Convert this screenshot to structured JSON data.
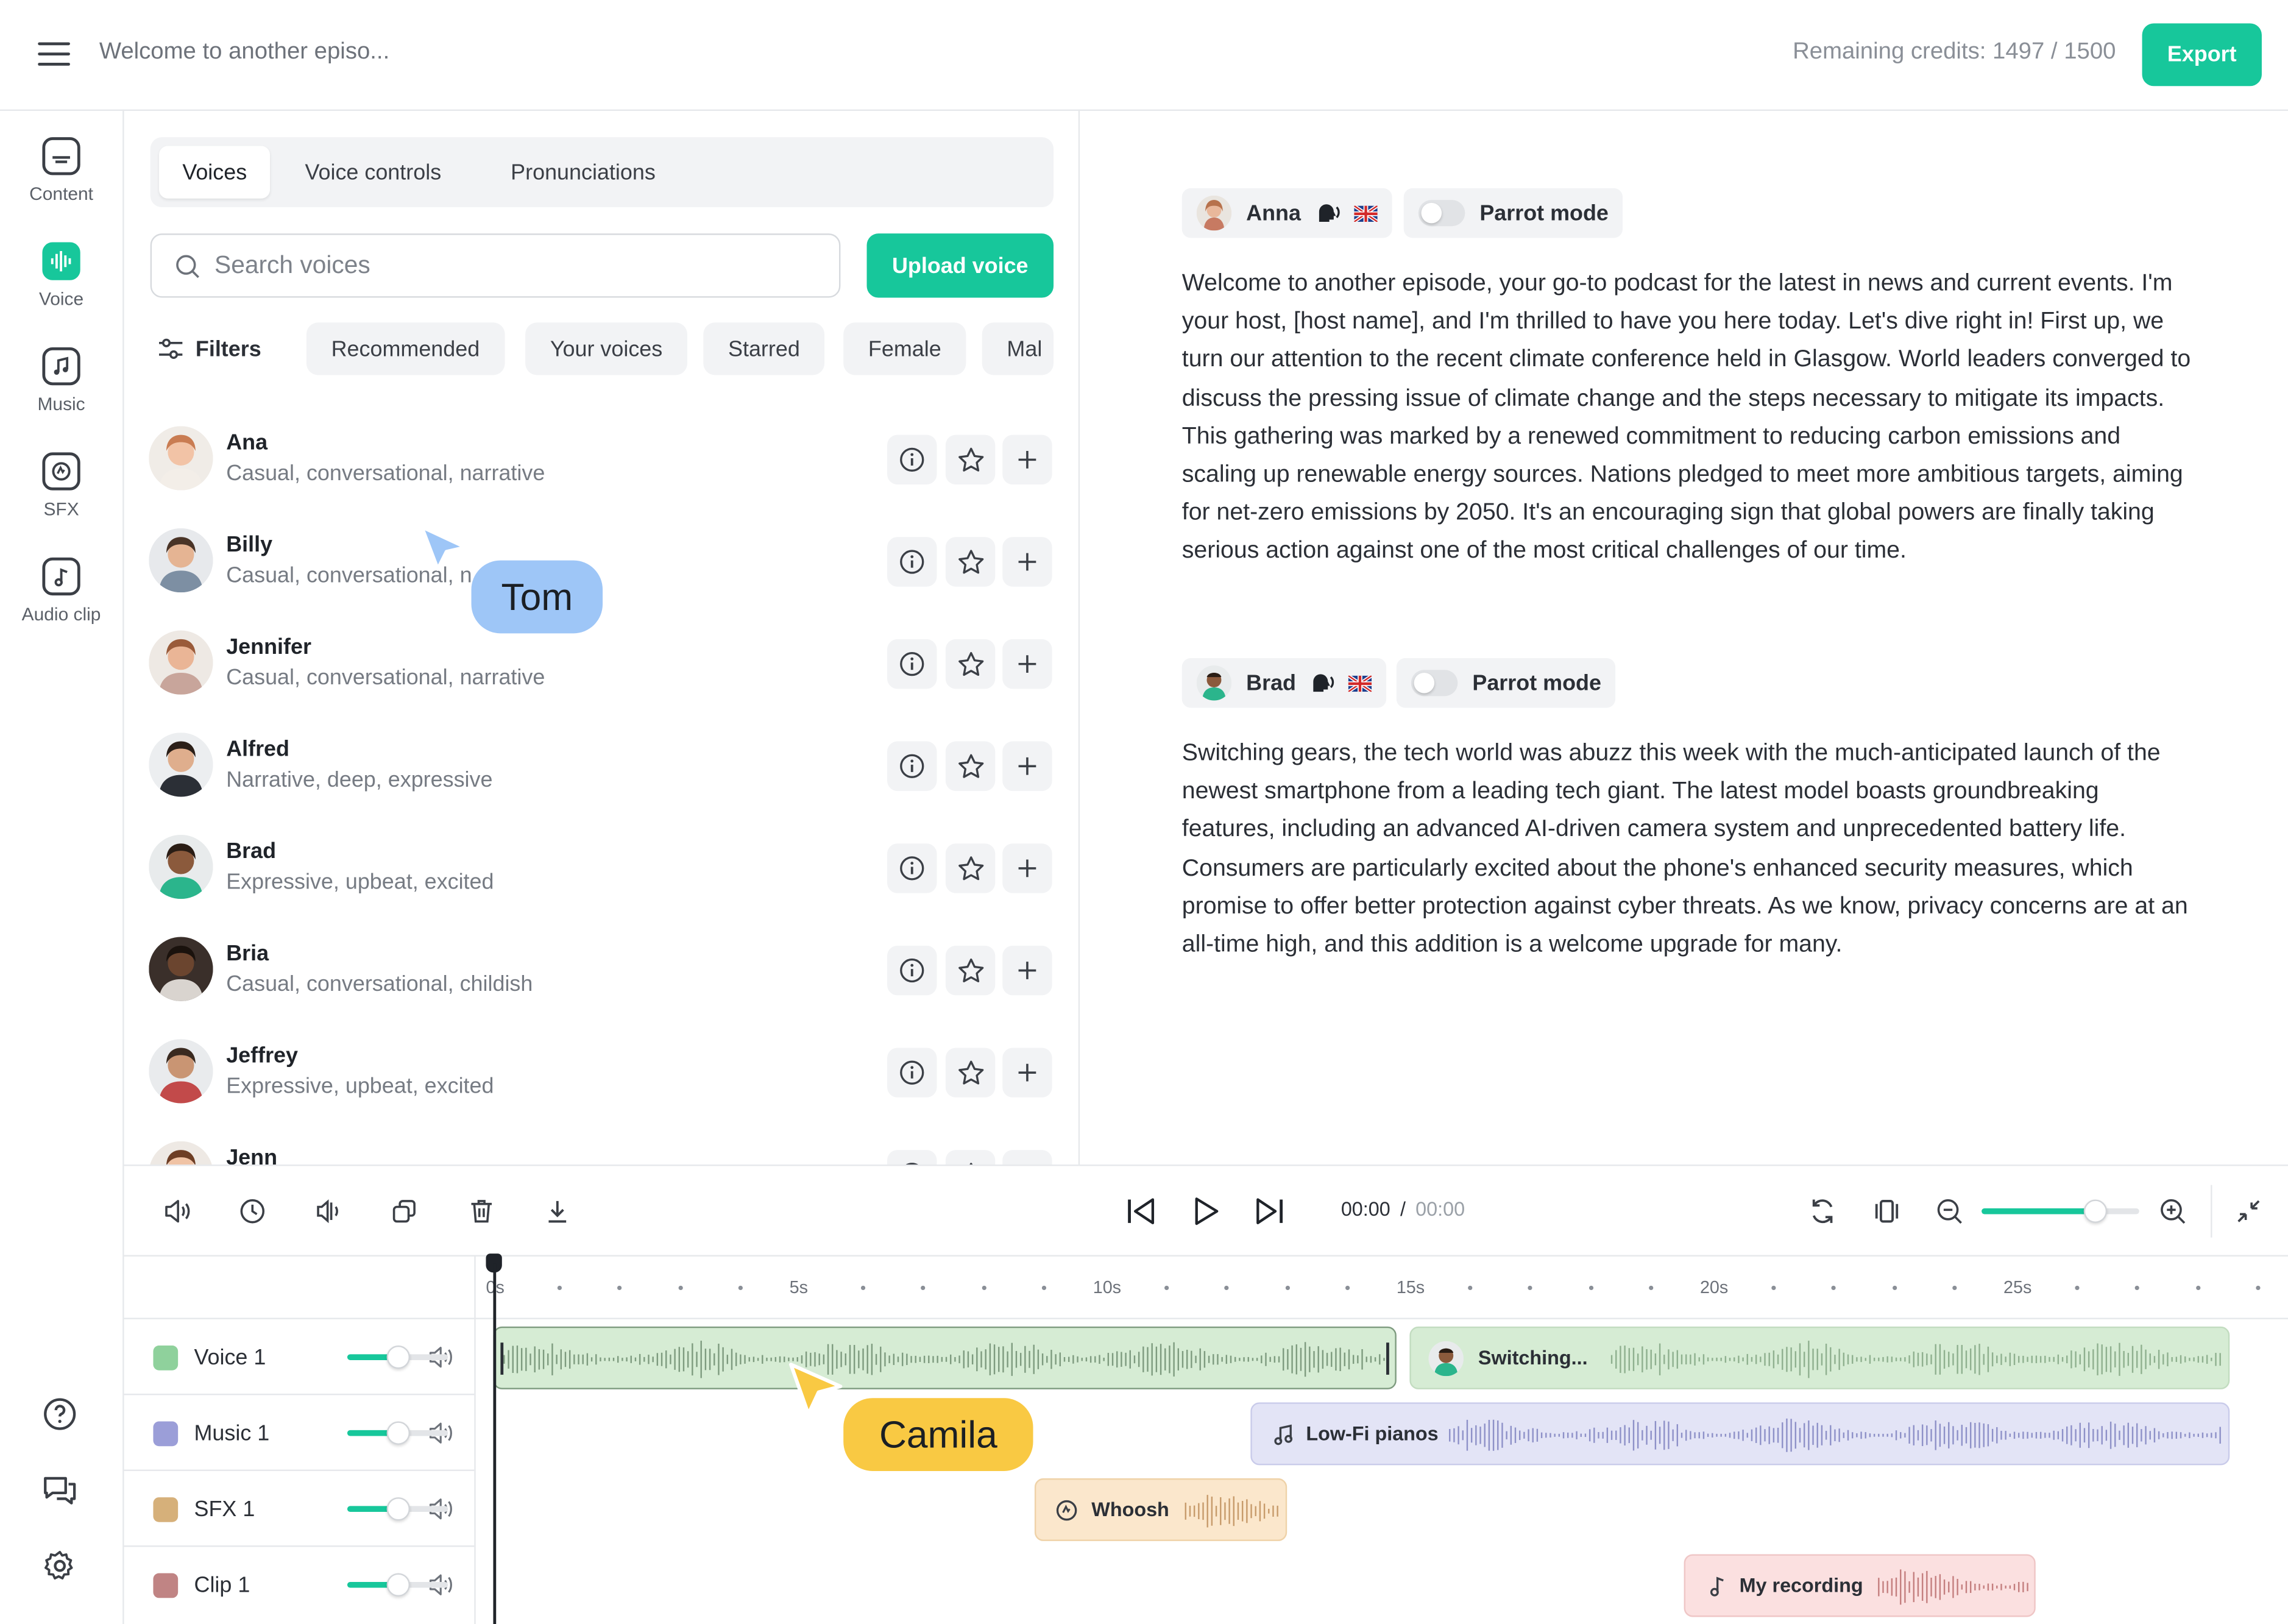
{
  "header": {
    "title": "Welcome to another episo...",
    "credits": "Remaining credits: 1497 / 1500",
    "export_label": "Export"
  },
  "nav": {
    "items": [
      {
        "label": "Content",
        "icon": "subtitles-icon"
      },
      {
        "label": "Voice",
        "icon": "waveform-icon"
      },
      {
        "label": "Music",
        "icon": "music-note-icon"
      },
      {
        "label": "SFX",
        "icon": "sfx-icon"
      },
      {
        "label": "Audio clip",
        "icon": "audio-clip-icon"
      }
    ]
  },
  "tabs": [
    "Voices",
    "Voice controls",
    "Pronunciations"
  ],
  "search": {
    "placeholder": "Search voices"
  },
  "upload_label": "Upload voice",
  "filters": {
    "label": "Filters",
    "chips": [
      "Recommended",
      "Your voices",
      "Starred",
      "Female",
      "Mal"
    ]
  },
  "voices": [
    {
      "name": "Ana",
      "desc": "Casual, conversational, narrative"
    },
    {
      "name": "Billy",
      "desc": "Casual, conversational, n"
    },
    {
      "name": "Jennifer",
      "desc": "Casual, conversational, narrative"
    },
    {
      "name": "Alfred",
      "desc": "Narrative, deep, expressive"
    },
    {
      "name": "Brad",
      "desc": "Expressive, upbeat, excited"
    },
    {
      "name": "Bria",
      "desc": "Casual, conversational, childish"
    },
    {
      "name": "Jeffrey",
      "desc": "Expressive, upbeat, excited"
    },
    {
      "name": "Jenn",
      "desc": ""
    }
  ],
  "cursors": {
    "tom": {
      "label": "Tom",
      "color": "#9ec6f7"
    },
    "camila": {
      "label": "Camila",
      "color": "#f9c943"
    }
  },
  "script": {
    "blocks": [
      {
        "speaker": "Anna",
        "parrot_label": "Parrot mode",
        "text": "Welcome to another episode, your go-to podcast for the latest in news and current events. I'm your host, [host name], and I'm thrilled to have you here today. Let's dive right in! First up, we turn our attention to the recent climate conference held in Glasgow. World leaders converged to discuss the pressing issue of climate change and the steps necessary to mitigate its impacts. This gathering was marked by a renewed commitment to reducing carbon emissions and scaling up renewable energy sources. Nations pledged to meet more ambitious targets, aiming for net-zero emissions by 2050. It's an encouraging sign that global powers are finally taking serious action against one of the most critical challenges of our time."
      },
      {
        "speaker": "Brad",
        "parrot_label": "Parrot mode",
        "text": "Switching gears, the tech world was abuzz this week with the much-anticipated launch of the newest smartphone from a leading tech giant. The latest model boasts groundbreaking features, including an advanced AI-driven camera system and unprecedented battery life. Consumers are particularly excited about the phone's enhanced security measures, which promise to offer better protection against cyber threats. As we know, privacy concerns are at an all-time high, and this addition is a welcome upgrade for many."
      }
    ]
  },
  "player": {
    "current_time": "00:00",
    "separator": "/",
    "total_time": "00:00",
    "zoom_level": 0.72
  },
  "timeline": {
    "ticks": [
      "0s",
      "5s",
      "10s",
      "15s",
      "20s",
      "25s"
    ],
    "tracks": [
      {
        "name": "Voice 1",
        "volume": 0.5,
        "color": "#8fd19c"
      },
      {
        "name": "Music 1",
        "volume": 0.5,
        "color": "#9b9ed8"
      },
      {
        "name": "SFX 1",
        "volume": 0.5,
        "color": "#d6b07a"
      },
      {
        "name": "Clip 1",
        "volume": 0.5,
        "color": "#c08484"
      }
    ],
    "clips": {
      "voice_b": "Switching...",
      "music": "Low-Fi pianos",
      "sfx": "Whoosh",
      "clip": "My recording"
    }
  },
  "colors": {
    "accent": "#17c79b",
    "voice_clip": "#d6ecd4",
    "music_clip": "#e3e4f6",
    "sfx_clip": "#fbe7cc",
    "rec_clip": "#fbe0e0"
  }
}
